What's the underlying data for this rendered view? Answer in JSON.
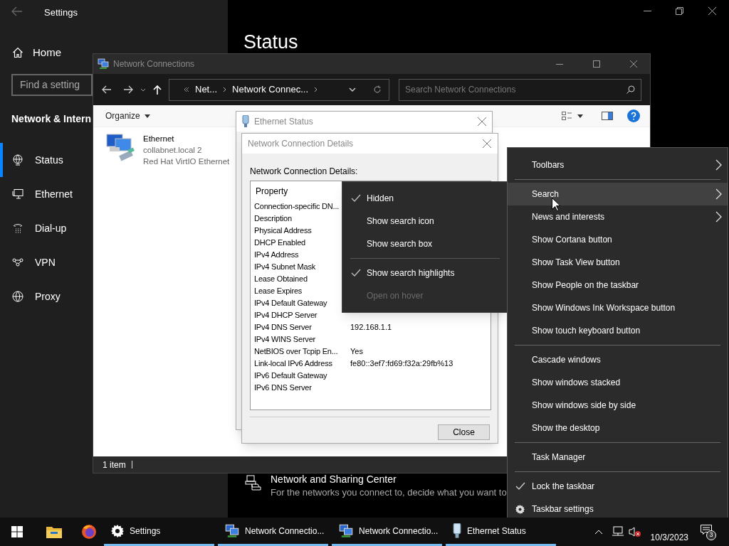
{
  "settings": {
    "title": "Settings",
    "home": "Home",
    "search_placeholder": "Find a setting",
    "section": "Network & Intern",
    "heading": "Status",
    "nav": [
      {
        "label": "Status",
        "selected": true
      },
      {
        "label": "Ethernet",
        "selected": false
      },
      {
        "label": "Dial-up",
        "selected": false
      },
      {
        "label": "VPN",
        "selected": false
      },
      {
        "label": "Proxy",
        "selected": false
      }
    ],
    "sharing_center": {
      "title": "Network and Sharing Center",
      "description": "For the networks you connect to, decide what you want to"
    }
  },
  "explorer": {
    "title": "Network Connections",
    "breadcrumb": [
      "Net...",
      "Network Connec..."
    ],
    "search_placeholder": "Search Network Connections",
    "organize": "Organize",
    "status_bar": "1 item",
    "items": [
      {
        "name": "Ethernet",
        "network": "collabnet.local 2",
        "adapter": "Red Hat VirtIO Ethernet"
      }
    ]
  },
  "ethernet_status": {
    "title": "Ethernet Status"
  },
  "details": {
    "title": "Network Connection Details",
    "label": "Network Connection Details:",
    "column": "Property",
    "close": "Close",
    "rows": [
      {
        "property": "Connection-specific DN..."
      },
      {
        "property": "Description"
      },
      {
        "property": "Physical Address"
      },
      {
        "property": "DHCP Enabled"
      },
      {
        "property": "IPv4 Address"
      },
      {
        "property": "IPv4 Subnet Mask"
      },
      {
        "property": "Lease Obtained"
      },
      {
        "property": "Lease Expires"
      },
      {
        "property": "IPv4 Default Gateway"
      },
      {
        "property": "IPv4 DHCP Server"
      },
      {
        "property": "IPv4 DNS Server",
        "value": "192.168.1.1"
      },
      {
        "property": "IPv4 WINS Server"
      },
      {
        "property": "NetBIOS over Tcpip En...",
        "value": "Yes"
      },
      {
        "property": "Link-local IPv6 Address",
        "value": "fe80::3ef7:fd69:f32a:29fb%13"
      },
      {
        "property": "IPv6 Default Gateway"
      },
      {
        "property": "IPv6 DNS Server"
      }
    ]
  },
  "search_submenu": [
    {
      "kind": "item",
      "label": "Hidden",
      "checked": true,
      "disabled": false
    },
    {
      "kind": "item",
      "label": "Show search icon",
      "checked": false,
      "disabled": false
    },
    {
      "kind": "item",
      "label": "Show search box",
      "checked": false,
      "disabled": false
    },
    {
      "kind": "separator"
    },
    {
      "kind": "item",
      "label": "Show search highlights",
      "checked": true,
      "disabled": false
    },
    {
      "kind": "item",
      "label": "Open on hover",
      "checked": false,
      "disabled": true
    }
  ],
  "context_menu": [
    {
      "kind": "item",
      "label": "Toolbars",
      "submenu": true,
      "highlighted": false,
      "checked": false
    },
    {
      "kind": "separator"
    },
    {
      "kind": "item",
      "label": "Search",
      "submenu": true,
      "highlighted": true,
      "checked": false
    },
    {
      "kind": "item",
      "label": "News and interests",
      "submenu": true,
      "highlighted": false,
      "checked": false
    },
    {
      "kind": "item",
      "label": "Show Cortana button",
      "submenu": false,
      "highlighted": false,
      "checked": false
    },
    {
      "kind": "item",
      "label": "Show Task View button",
      "submenu": false,
      "highlighted": false,
      "checked": false
    },
    {
      "kind": "item",
      "label": "Show People on the taskbar",
      "submenu": false,
      "highlighted": false,
      "checked": false
    },
    {
      "kind": "item",
      "label": "Show Windows Ink Workspace button",
      "submenu": false,
      "highlighted": false,
      "checked": false
    },
    {
      "kind": "item",
      "label": "Show touch keyboard button",
      "submenu": false,
      "highlighted": false,
      "checked": false
    },
    {
      "kind": "separator"
    },
    {
      "kind": "item",
      "label": "Cascade windows",
      "submenu": false,
      "highlighted": false,
      "checked": false
    },
    {
      "kind": "item",
      "label": "Show windows stacked",
      "submenu": false,
      "highlighted": false,
      "checked": false
    },
    {
      "kind": "item",
      "label": "Show windows side by side",
      "submenu": false,
      "highlighted": false,
      "checked": false
    },
    {
      "kind": "item",
      "label": "Show the desktop",
      "submenu": false,
      "highlighted": false,
      "checked": false
    },
    {
      "kind": "separator"
    },
    {
      "kind": "item",
      "label": "Task Manager",
      "submenu": false,
      "highlighted": false,
      "checked": false
    },
    {
      "kind": "separator"
    },
    {
      "kind": "item",
      "label": "Lock the taskbar",
      "submenu": false,
      "highlighted": false,
      "checked": true
    },
    {
      "kind": "settings",
      "label": "Taskbar settings"
    }
  ],
  "taskbar": {
    "buttons": [
      {
        "kind": "settings",
        "label": "Settings"
      },
      {
        "kind": "network",
        "label": "Network Connectio..."
      },
      {
        "kind": "network",
        "label": "Network Connectio..."
      },
      {
        "kind": "ethernet",
        "label": "Ethernet Status"
      }
    ],
    "date": "10/3/2023",
    "notifications": "3"
  }
}
